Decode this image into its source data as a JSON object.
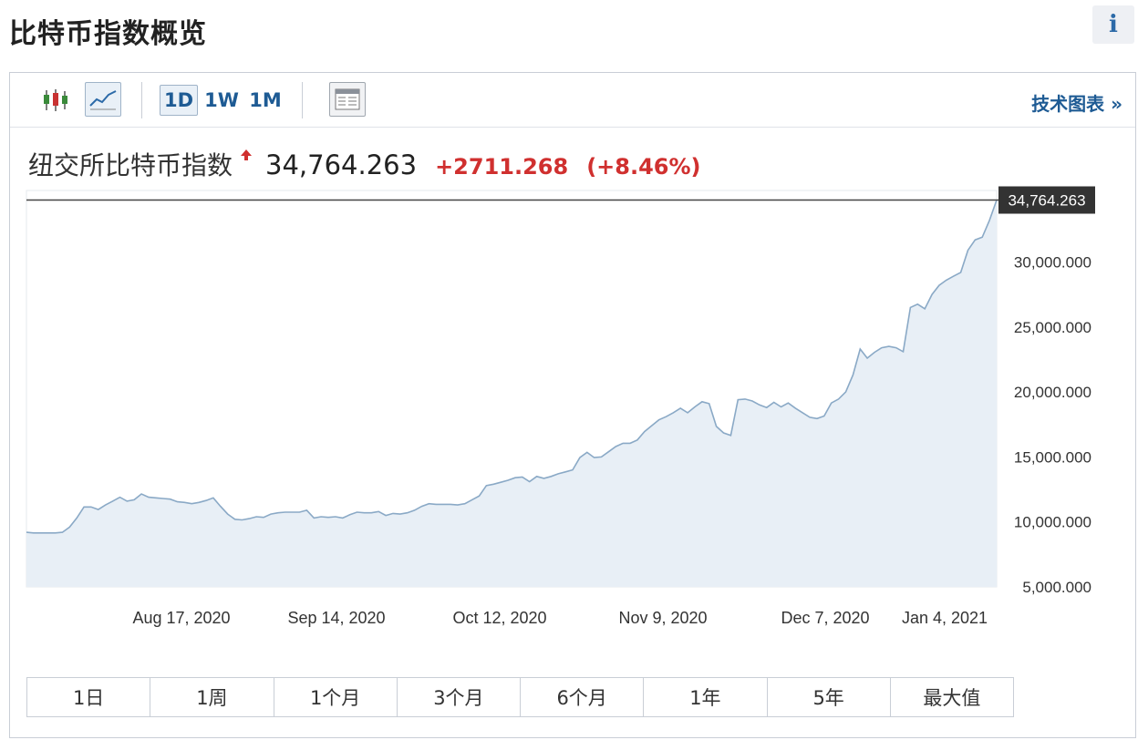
{
  "header": {
    "title": "比特币指数概览",
    "info_icon_glyph": "i"
  },
  "toolbar": {
    "candlestick_icon": "candlestick-chart-icon",
    "line_icon": "line-chart-icon",
    "periods": [
      "1D",
      "1W",
      "1M"
    ],
    "selected_period": "1D",
    "table_icon": "data-table-icon",
    "tech_chart_label": "技术图表 »"
  },
  "quote": {
    "name": "纽交所比特币指数",
    "price": "34,764.263",
    "change": "+2711.268",
    "change_pct": "(+8.46%)",
    "direction": "up"
  },
  "colors": {
    "accent": "#1e5b94",
    "up": "#d0302f",
    "line": "#8aa9c6",
    "area": "#e8eff6",
    "last_price_bg": "#333333"
  },
  "chart_data": {
    "type": "area",
    "series": [
      {
        "values": [
          9200,
          9150,
          9150,
          9150,
          9150,
          9200,
          9600,
          10300,
          11150,
          11150,
          10950,
          11300,
          11600,
          11900,
          11600,
          11700,
          12150,
          11900,
          11850,
          11800,
          11750,
          11550,
          11500,
          11400,
          11500,
          11650,
          11850,
          11200,
          10600,
          10200,
          10150,
          10250,
          10400,
          10350,
          10600,
          10700,
          10750,
          10750,
          10750,
          10900,
          10300,
          10400,
          10350,
          10400,
          10300,
          10550,
          10750,
          10700,
          10700,
          10800,
          10500,
          10650,
          10600,
          10700,
          10900,
          11200,
          11400,
          11350,
          11350,
          11350,
          11300,
          11400,
          11700,
          12000,
          12800,
          12900,
          13050,
          13200,
          13400,
          13450,
          13100,
          13500,
          13350,
          13500,
          13700,
          13850,
          14000,
          14950,
          15350,
          14950,
          15000,
          15400,
          15800,
          16050,
          16050,
          16300,
          16950,
          17400,
          17850,
          18100,
          18400,
          18750,
          18400,
          18850,
          19250,
          19100,
          17350,
          16850,
          16650,
          19400,
          19450,
          19300,
          19000,
          18800,
          19200,
          18850,
          19150,
          18750,
          18400,
          18050,
          17950,
          18150,
          19150,
          19450,
          20000,
          21300,
          23300,
          22600,
          23050,
          23400,
          23500,
          23400,
          23100,
          26500,
          26750,
          26400,
          27500,
          28200,
          28600,
          28900,
          29200,
          30900,
          31700,
          31900,
          33200,
          34764.263
        ]
      }
    ],
    "x_tick_labels": [
      "Aug 17, 2020",
      "Sep 14, 2020",
      "Oct 12, 2020",
      "Nov 9, 2020",
      "Dec 7, 2020",
      "Jan 4, 2021"
    ],
    "y_tick_labels": [
      "5,000.000",
      "10,000.000",
      "15,000.000",
      "20,000.000",
      "25,000.000",
      "30,000.000"
    ],
    "y_ticks": [
      5000,
      10000,
      15000,
      20000,
      25000,
      30000
    ],
    "ylim": [
      5000,
      35500
    ],
    "last_value": 34764.263,
    "last_value_label": "34,764.263",
    "grid": false,
    "title": "",
    "xlabel": "",
    "ylabel": ""
  },
  "ranges": [
    "1日",
    "1周",
    "1个月",
    "3个月",
    "6个月",
    "1年",
    "5年",
    "最大值"
  ]
}
